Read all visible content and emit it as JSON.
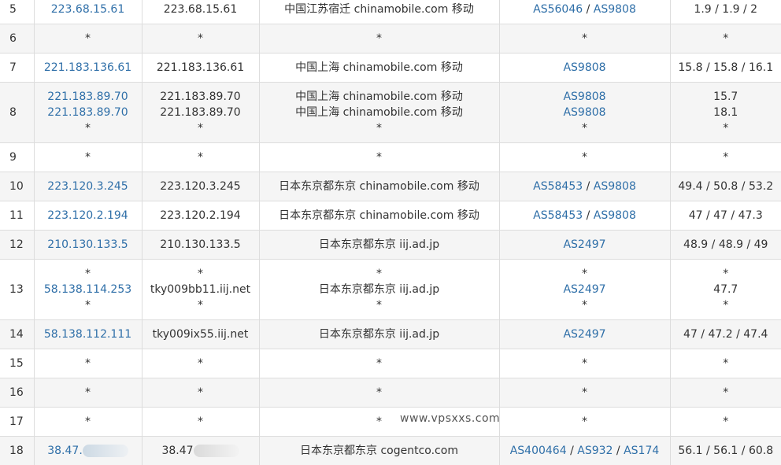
{
  "watermark": "www.vpsxxs.com",
  "rows": [
    {
      "hop": "5",
      "lines": [
        {
          "ip": "223.68.15.61",
          "host": "223.68.15.61",
          "loc": "中国江苏宿迁 chinamobile.com 移动",
          "as": [
            "AS56046",
            "AS9808"
          ],
          "rtt": "1.9 / 1.9 / 2"
        }
      ]
    },
    {
      "hop": "6",
      "lines": [
        {
          "ip": "*",
          "host": "*",
          "loc": "*",
          "as": [
            "*"
          ],
          "rtt": "*"
        }
      ]
    },
    {
      "hop": "7",
      "lines": [
        {
          "ip": "221.183.136.61",
          "host": "221.183.136.61",
          "loc": "中国上海 chinamobile.com 移动",
          "as": [
            "AS9808"
          ],
          "rtt": "15.8 / 15.8 / 16.1"
        }
      ]
    },
    {
      "hop": "8",
      "lines": [
        {
          "ip": "221.183.89.70",
          "host": "221.183.89.70",
          "loc": "中国上海 chinamobile.com 移动",
          "as": [
            "AS9808"
          ],
          "rtt": "15.7"
        },
        {
          "ip": "221.183.89.70",
          "host": "221.183.89.70",
          "loc": "中国上海 chinamobile.com 移动",
          "as": [
            "AS9808"
          ],
          "rtt": "18.1"
        },
        {
          "ip": "*",
          "host": "*",
          "loc": "*",
          "as": [
            "*"
          ],
          "rtt": "*"
        }
      ]
    },
    {
      "hop": "9",
      "lines": [
        {
          "ip": "*",
          "host": "*",
          "loc": "*",
          "as": [
            "*"
          ],
          "rtt": "*"
        }
      ]
    },
    {
      "hop": "10",
      "lines": [
        {
          "ip": "223.120.3.245",
          "host": "223.120.3.245",
          "loc": "日本东京都东京 chinamobile.com 移动",
          "as": [
            "AS58453",
            "AS9808"
          ],
          "rtt": "49.4 / 50.8 / 53.2"
        }
      ]
    },
    {
      "hop": "11",
      "lines": [
        {
          "ip": "223.120.2.194",
          "host": "223.120.2.194",
          "loc": "日本东京都东京 chinamobile.com 移动",
          "as": [
            "AS58453",
            "AS9808"
          ],
          "rtt": "47 / 47 / 47.3"
        }
      ]
    },
    {
      "hop": "12",
      "lines": [
        {
          "ip": "210.130.133.5",
          "host": "210.130.133.5",
          "loc": "日本东京都东京 iij.ad.jp",
          "as": [
            "AS2497"
          ],
          "rtt": "48.9 / 48.9 / 49"
        }
      ]
    },
    {
      "hop": "13",
      "lines": [
        {
          "ip": "*",
          "host": "*",
          "loc": "*",
          "as": [
            "*"
          ],
          "rtt": "*"
        },
        {
          "ip": "58.138.114.253",
          "host": "tky009bb11.iij.net",
          "loc": "日本东京都东京 iij.ad.jp",
          "as": [
            "AS2497"
          ],
          "rtt": "47.7"
        },
        {
          "ip": "*",
          "host": "*",
          "loc": "*",
          "as": [
            "*"
          ],
          "rtt": "*"
        }
      ]
    },
    {
      "hop": "14",
      "lines": [
        {
          "ip": "58.138.112.111",
          "host": "tky009ix55.iij.net",
          "loc": "日本东京都东京 iij.ad.jp",
          "as": [
            "AS2497"
          ],
          "rtt": "47 / 47.2 / 47.4"
        }
      ]
    },
    {
      "hop": "15",
      "lines": [
        {
          "ip": "*",
          "host": "*",
          "loc": "*",
          "as": [
            "*"
          ],
          "rtt": "*"
        }
      ]
    },
    {
      "hop": "16",
      "lines": [
        {
          "ip": "*",
          "host": "*",
          "loc": "*",
          "as": [
            "*"
          ],
          "rtt": "*"
        }
      ]
    },
    {
      "hop": "17",
      "lines": [
        {
          "ip": "*",
          "host": "*",
          "loc": "*",
          "as": [
            "*"
          ],
          "rtt": "*"
        }
      ]
    },
    {
      "hop": "18",
      "lines": [
        {
          "ip": "38.47.",
          "host": "38.47",
          "loc": "日本东京都东京 cogentco.com",
          "as": [
            "AS400464",
            "AS932",
            "AS174"
          ],
          "rtt": "56.1 / 56.1 / 60.8"
        }
      ]
    }
  ],
  "redacted_hops": [
    "18"
  ]
}
